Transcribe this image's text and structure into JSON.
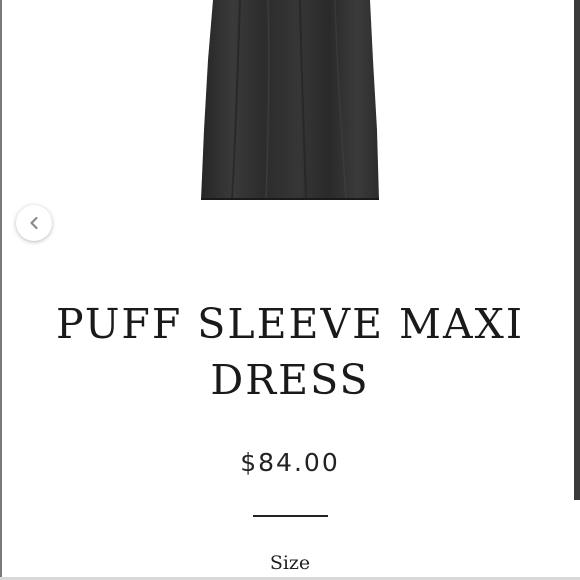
{
  "product": {
    "title_line1": "PUFF SLEEVE MAXI",
    "title_line2": "DRESS",
    "price": "$84.00",
    "size_label": "Size",
    "image_color": "#2b2b2b"
  },
  "gallery": {
    "prev_icon": "chevron-left-icon"
  }
}
